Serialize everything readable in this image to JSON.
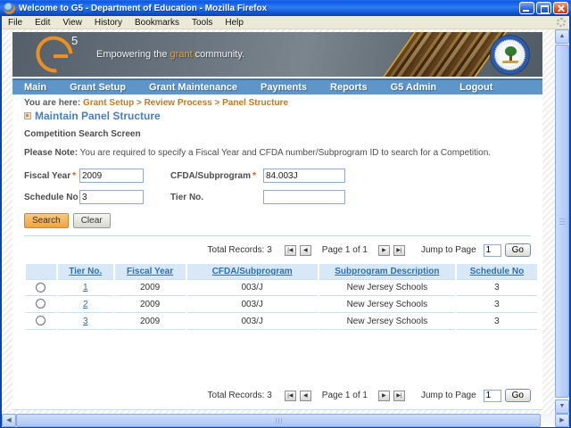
{
  "window": {
    "title": "Welcome to G5 - Department of Education - Mozilla Firefox"
  },
  "menubar": {
    "items": [
      "File",
      "Edit",
      "View",
      "History",
      "Bookmarks",
      "Tools",
      "Help"
    ]
  },
  "banner": {
    "logo_five": "5",
    "tagline_pre": "Empowering the ",
    "tagline_highlight": "grant",
    "tagline_post": " community."
  },
  "nav": {
    "items": [
      "Main",
      "Grant Setup",
      "Grant Maintenance",
      "Payments",
      "Reports",
      "G5 Admin",
      "Logout"
    ]
  },
  "breadcrumb": {
    "prefix": "You are here: ",
    "path": "Grant Setup > Review Process > Panel Structure"
  },
  "page": {
    "title": "Maintain Panel Structure",
    "section_title": "Competition Search Screen",
    "note_label": "Please Note:",
    "note_text": " You are required to specify a Fiscal Year and CFDA number/Subprogram ID to search for a Competition.",
    "required_marker": "*"
  },
  "form": {
    "fields": [
      {
        "label": "Fiscal Year",
        "value": "2009"
      },
      {
        "label": "CFDA/Subprogram",
        "value": "84.003J"
      },
      {
        "label": "Schedule No",
        "value": "3"
      },
      {
        "label": "Tier No.",
        "value": ""
      }
    ],
    "search_label": "Search",
    "clear_label": "Clear"
  },
  "pagination": {
    "total_label": "Total Records: 3",
    "page_label": "Page 1 of 1",
    "jump_label": "Jump to Page",
    "jump_value": "1",
    "go_label": "Go"
  },
  "icons": {
    "first": "|◀",
    "prev": "◀",
    "next": "▶",
    "last": "▶|",
    "scroll_up": "▲",
    "scroll_down": "▼",
    "scroll_left": "◀",
    "scroll_right": "▶"
  },
  "table": {
    "columns": [
      "Tier No.",
      "Fiscal Year",
      "CFDA/Subprogram",
      "Subprogram Description",
      "Schedule No"
    ],
    "rows": [
      {
        "tier": "1",
        "fiscal_year": "2009",
        "cfda": "003/J",
        "description": "New Jersey Schools",
        "schedule": "3"
      },
      {
        "tier": "2",
        "fiscal_year": "2009",
        "cfda": "003/J",
        "description": "New Jersey Schools",
        "schedule": "3"
      },
      {
        "tier": "3",
        "fiscal_year": "2009",
        "cfda": "003/J",
        "description": "New Jersey Schools",
        "schedule": "3"
      }
    ]
  },
  "colors": {
    "navbar_blue": "#5e96c9",
    "table_header_bg": "#d8e8f6",
    "link_blue": "#2c6fad",
    "breadcrumb_orange": "#be7a26",
    "search_button_orange": "#f0a43f",
    "banner_accent_orange": "#ee8f1f"
  }
}
